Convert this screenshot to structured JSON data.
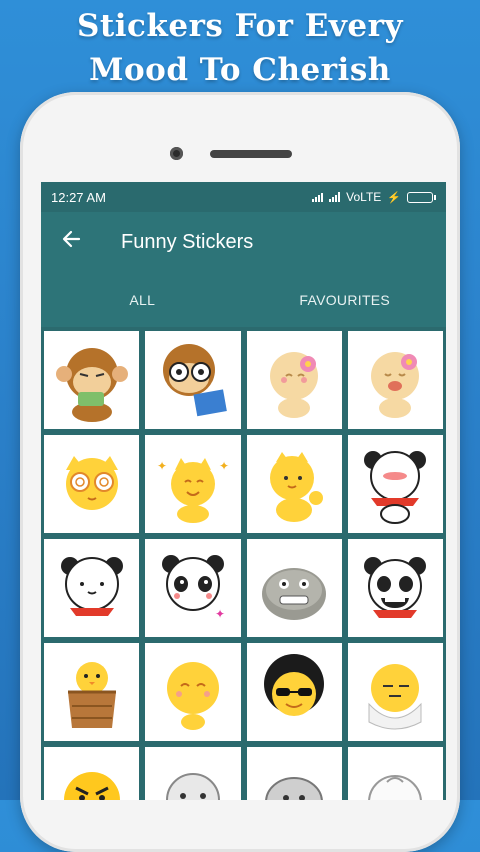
{
  "promo": {
    "line1": "Stickers For Every",
    "line2": "Mood To Cherish"
  },
  "status_bar": {
    "time": "12:27 AM",
    "network": "VoLTE",
    "charging": true
  },
  "toolbar": {
    "back_icon": "arrow-left-icon",
    "title": "Funny Stickers"
  },
  "tabs": [
    {
      "label": "ALL",
      "selected": true
    },
    {
      "label": "FAVOURITES",
      "selected": false
    }
  ],
  "stickers": [
    "monkey-money-sticker",
    "monkey-glasses-book-sticker",
    "cat-flower-shy-sticker",
    "cat-flower-laugh-sticker",
    "cat-dizzy-eyes-sticker",
    "cat-sparkle-sticker",
    "cat-wave-sticker",
    "panda-blush-scarf-sticker",
    "panda-smile-sticker",
    "panda-cute-sticker",
    "rock-grin-sticker",
    "panda-grin-sticker",
    "chick-basket-sticker",
    "yellow-blob-sticker",
    "afro-sunglasses-sticker",
    "egg-face-sticker",
    "angry-yellow-sticker",
    "gray-face-sticker",
    "gray-blob-sticker",
    "white-bun-sticker"
  ],
  "colors": {
    "background": "#2f8fd8",
    "app_bar": "#2d7478",
    "status_bar": "#2a6a6e"
  }
}
